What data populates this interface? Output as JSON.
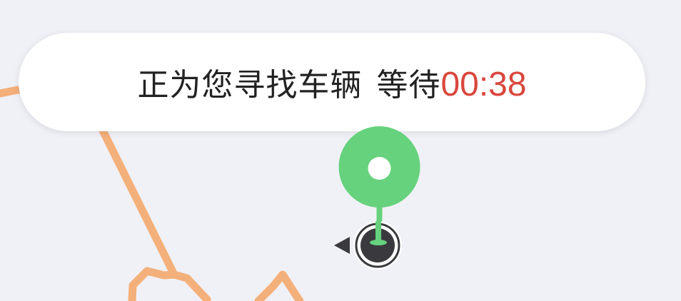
{
  "status_bubble": {
    "message": "正为您寻找车辆",
    "wait_label": "等待",
    "countdown": "00:38"
  },
  "map": {
    "route_color": "#f4b07a",
    "background": "#f0f1f7"
  },
  "pin": {
    "color": "#66d27d",
    "icon": "pickup-pin-icon"
  },
  "locator": {
    "icon": "current-location-icon",
    "color": "#3a3a3e"
  }
}
